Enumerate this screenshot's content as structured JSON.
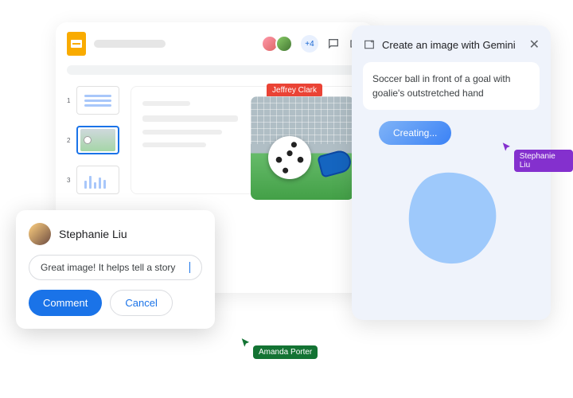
{
  "app": {
    "share_count": "+4"
  },
  "thumbs": [
    {
      "num": "1"
    },
    {
      "num": "2"
    },
    {
      "num": "3"
    }
  ],
  "canvas": {
    "collaborator_tag": "Jeffrey Clark"
  },
  "comment": {
    "author": "Stephanie Liu",
    "input_value": "Great image! It helps tell a story",
    "submit_label": "Comment",
    "cancel_label": "Cancel"
  },
  "gemini": {
    "title": "Create an image with Gemini",
    "prompt": "Soccer ball in front of a goal with goalie's outstretched hand",
    "status": "Creating..."
  },
  "cursors": {
    "purple": "Stephanie Liu",
    "green": "Amanda Porter"
  }
}
